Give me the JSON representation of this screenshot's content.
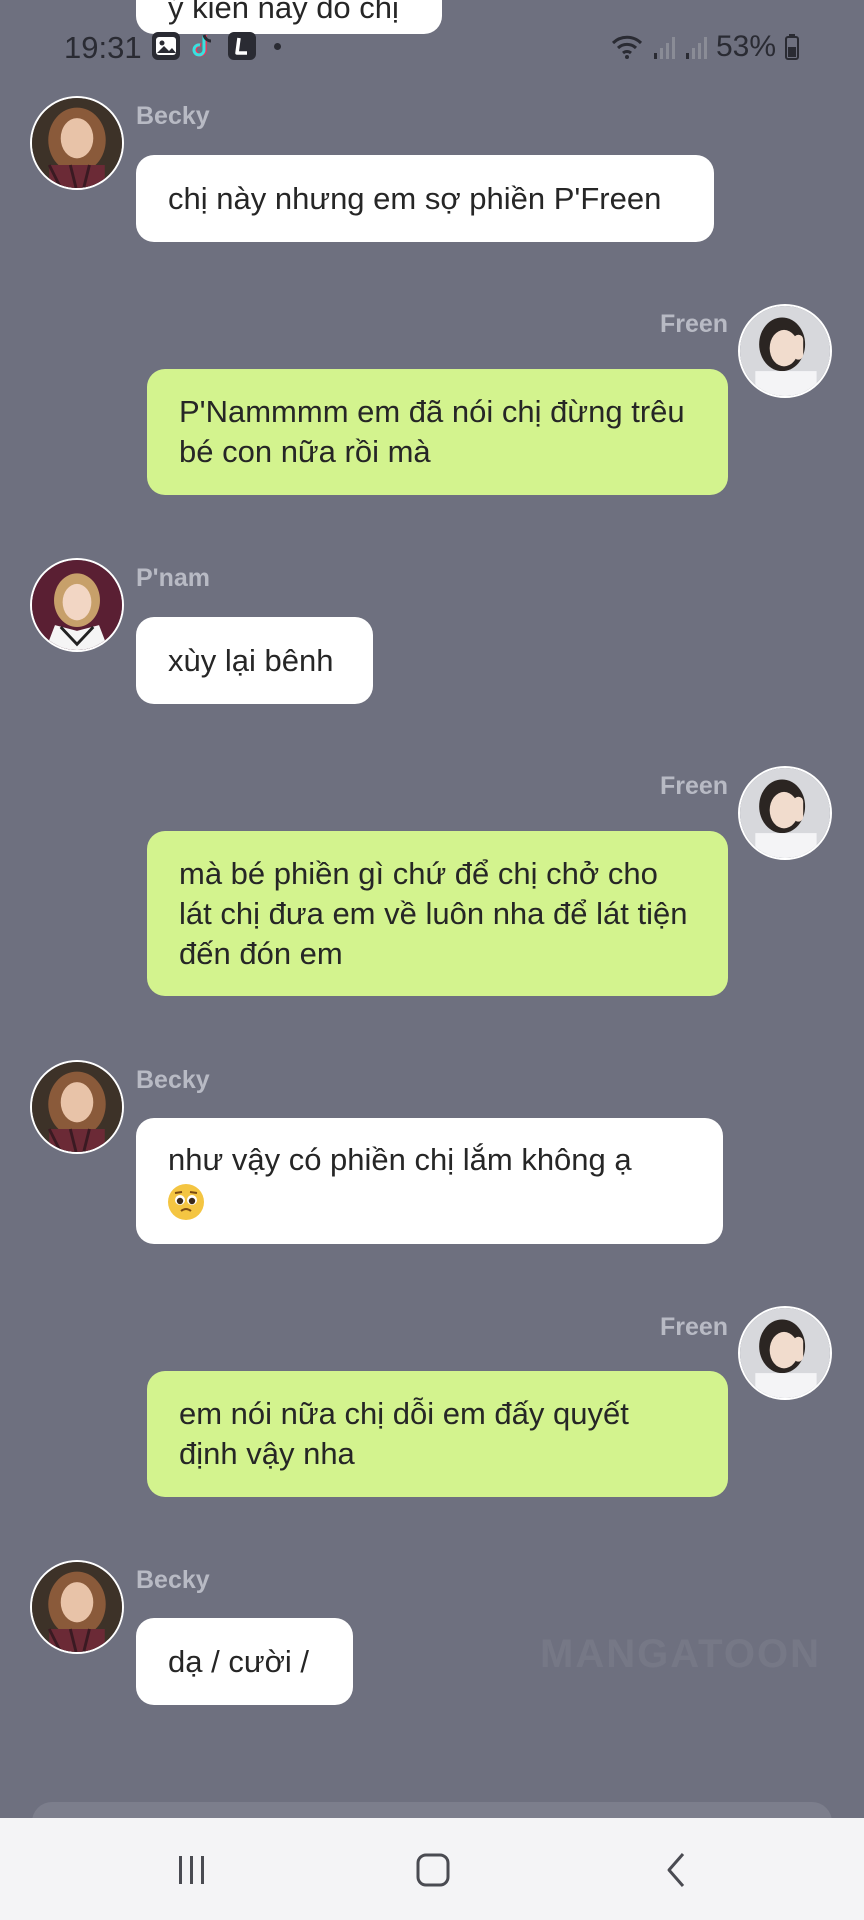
{
  "status_bar": {
    "time": "19:31",
    "battery": "53%",
    "icons": [
      "gallery-icon",
      "tiktok-icon",
      "l-app-icon",
      "wifi-icon",
      "signal-icon",
      "signal-icon",
      "battery-icon"
    ]
  },
  "messages": [
    {
      "sender": "",
      "text": "ý kiến này đó chị",
      "side": "in"
    },
    {
      "sender": "Becky",
      "text": "chị này nhưng em sợ phiền P'Freen",
      "side": "in"
    },
    {
      "sender": "Freen",
      "text": "P'Nammmm em đã nói chị đừng trêu bé con nữa rồi mà",
      "side": "out"
    },
    {
      "sender": "P'nam",
      "text": "xùy lại bênh",
      "side": "in"
    },
    {
      "sender": "Freen",
      "text": "mà bé phiền gì chứ để chị chở cho lát chị đưa em về luôn nha để lát tiện đến đón em",
      "side": "out"
    },
    {
      "sender": "Becky",
      "text": "như vậy có phiền chị lắm không ạ",
      "emoji": "pleading-face",
      "side": "in"
    },
    {
      "sender": "Freen",
      "text": "em nói nữa chị dỗi em đấy quyết định vậy nha",
      "side": "out"
    },
    {
      "sender": "Becky",
      "text": "dạ / cười /",
      "side": "in"
    }
  ],
  "watermark": "MANGATOON",
  "colors": {
    "background": "#6e707f",
    "incoming_bubble": "#ffffff",
    "outgoing_bubble": "#d3f38e",
    "sender_name": "#b8bac4"
  },
  "nav": {
    "buttons": [
      "recent-apps-icon",
      "home-icon",
      "back-icon"
    ]
  }
}
